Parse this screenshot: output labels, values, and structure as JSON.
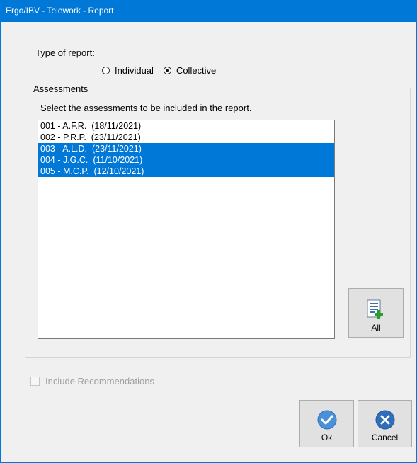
{
  "window": {
    "title": "Ergo/IBV - Telework - Report"
  },
  "report_type": {
    "label": "Type of report:",
    "options": [
      {
        "label": "Individual",
        "checked": false
      },
      {
        "label": "Collective",
        "checked": true
      }
    ]
  },
  "assessments": {
    "group_label": "Assessments",
    "instruction": "Select the assessments to be included in the report.",
    "items": [
      {
        "text": "001 - A.F.R.  (18/11/2021)",
        "selected": false
      },
      {
        "text": "002 - P.R.P.  (23/11/2021)",
        "selected": false
      },
      {
        "text": "003 - A.L.D.  (23/11/2021)",
        "selected": true
      },
      {
        "text": "004 - J.G.C.  (11/10/2021)",
        "selected": true
      },
      {
        "text": "005 - M.C.P.  (12/10/2021)",
        "selected": true
      }
    ],
    "all_button_label": "All"
  },
  "recommendations": {
    "label": "Include Recommendations",
    "checked": false,
    "enabled": false
  },
  "buttons": {
    "ok_label": "Ok",
    "cancel_label": "Cancel"
  },
  "colors": {
    "accent": "#0078d7",
    "selection": "#0078d7",
    "ok_icon": "#4a90d9",
    "cancel_icon": "#2f6fb8"
  },
  "icons": {
    "all_button": "select-all-list-icon",
    "ok_button": "checkmark-circle-icon",
    "cancel_button": "x-circle-icon"
  }
}
